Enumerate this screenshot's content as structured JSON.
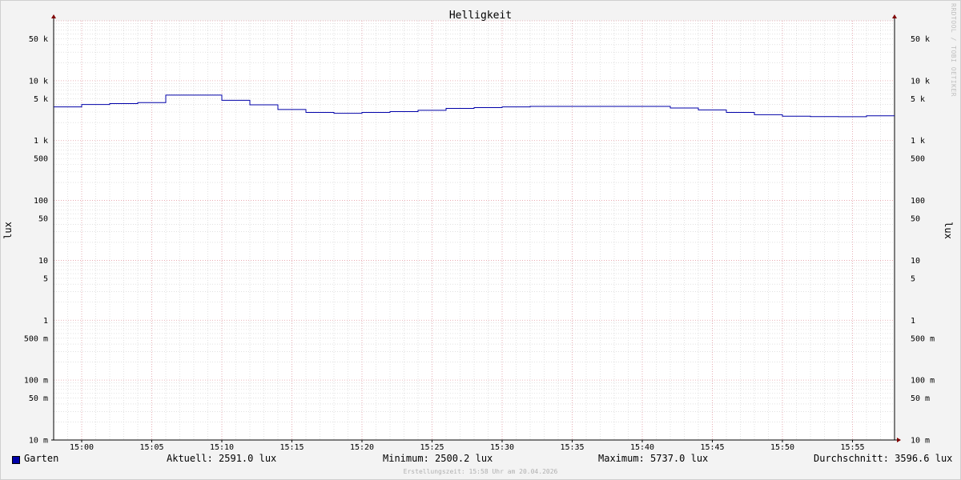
{
  "chart_data": {
    "type": "line",
    "title": "Helligkeit",
    "ylabel": "lux",
    "y_scale": "log",
    "ylim": [
      0.01,
      100000
    ],
    "xlim": [
      "14:58",
      "15:58"
    ],
    "x_tick_labels": [
      "15:00",
      "15:05",
      "15:10",
      "15:15",
      "15:20",
      "15:25",
      "15:30",
      "15:35",
      "15:40",
      "15:45",
      "15:50",
      "15:55"
    ],
    "y_tick_labels": [
      {
        "value": 0.01,
        "label": "10 m"
      },
      {
        "value": 0.05,
        "label": "50 m"
      },
      {
        "value": 0.1,
        "label": "100 m"
      },
      {
        "value": 0.5,
        "label": "500 m"
      },
      {
        "value": 1,
        "label": "1"
      },
      {
        "value": 5,
        "label": "5"
      },
      {
        "value": 10,
        "label": "10"
      },
      {
        "value": 50,
        "label": "50"
      },
      {
        "value": 100,
        "label": "100"
      },
      {
        "value": 500,
        "label": "500"
      },
      {
        "value": 1000,
        "label": "1 k"
      },
      {
        "value": 5000,
        "label": "5 k"
      },
      {
        "value": 10000,
        "label": "10 k"
      },
      {
        "value": 50000,
        "label": "50 k"
      }
    ],
    "grid": true,
    "series": [
      {
        "name": "Garten",
        "color": "#0000a8",
        "x": [
          "14:58",
          "15:00",
          "15:02",
          "15:04",
          "15:06",
          "15:08",
          "15:10",
          "15:12",
          "15:14",
          "15:16",
          "15:18",
          "15:20",
          "15:22",
          "15:24",
          "15:26",
          "15:28",
          "15:30",
          "15:32",
          "15:34",
          "15:36",
          "15:38",
          "15:40",
          "15:42",
          "15:44",
          "15:46",
          "15:48",
          "15:50",
          "15:52",
          "15:54",
          "15:56",
          "15:58"
        ],
        "y": [
          3650,
          4000,
          4150,
          4300,
          5737,
          5737,
          4700,
          3950,
          3300,
          2950,
          2850,
          2950,
          3050,
          3200,
          3450,
          3550,
          3650,
          3720,
          3720,
          3720,
          3720,
          3720,
          3500,
          3250,
          2950,
          2700,
          2550,
          2510,
          2500.2,
          2591,
          2591
        ]
      }
    ]
  },
  "legend": {
    "series_name": "Garten",
    "current": "Aktuell: 2591.0 lux",
    "minimum": "Minimum: 2500.2 lux",
    "maximum": "Maximum: 5737.0 lux",
    "average": "Durchschnitt: 3596.6 lux"
  },
  "footer": "Erstellungszeit: 15:58 Uhr am 20.04.2026",
  "watermark": "RRDTOOL / TOBI OETIKER",
  "colors": {
    "line": "#0000a8",
    "major_grid": "#e8a0a8",
    "minor_grid": "#cfcfcf",
    "arrow": "#800000"
  }
}
